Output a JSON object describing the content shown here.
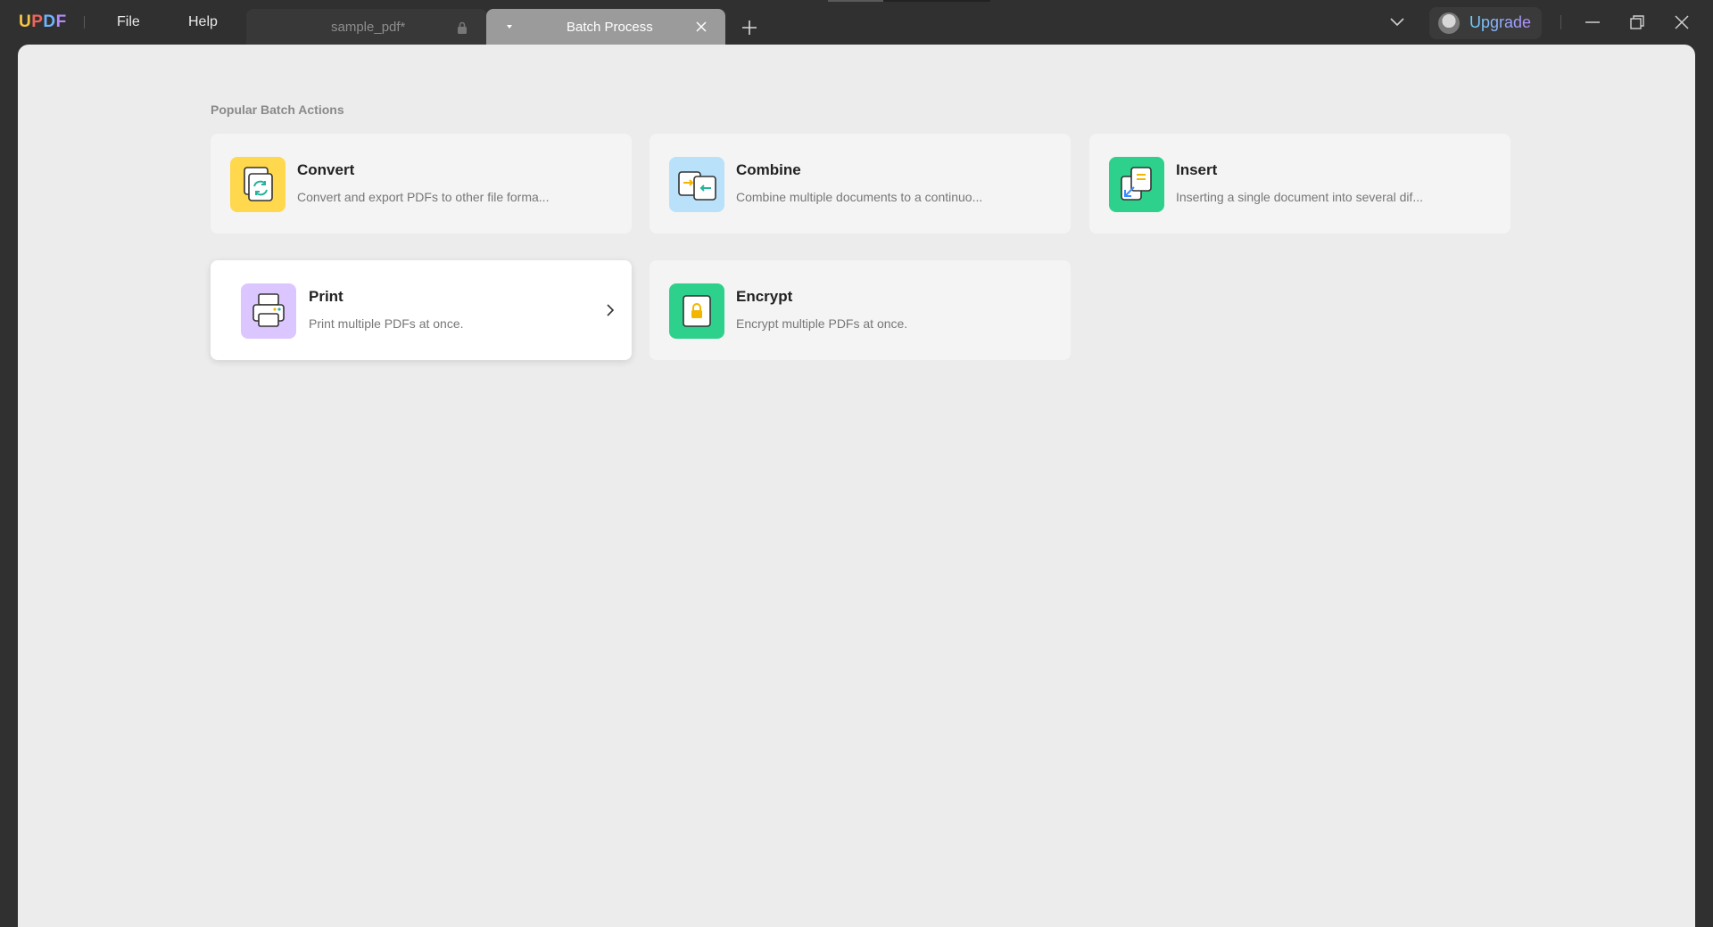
{
  "app": {
    "logo": {
      "u": "U",
      "p": "P",
      "d": "D",
      "f": "F"
    },
    "menu": {
      "file": "File",
      "help": "Help"
    }
  },
  "tabs": [
    {
      "label": "sample_pdf*",
      "locked": true,
      "active": false
    },
    {
      "label": "Batch Process",
      "active": true
    }
  ],
  "header": {
    "upgrade_label": "Upgrade"
  },
  "main": {
    "section_title": "Popular Batch Actions",
    "actions": [
      {
        "title": "Convert",
        "description": "Convert and export PDFs to other file forma...",
        "icon": "convert-icon",
        "color": "#ffd84d"
      },
      {
        "title": "Combine",
        "description": "Combine multiple documents to a continuo...",
        "icon": "combine-icon",
        "color": "#b9e1fa"
      },
      {
        "title": "Insert",
        "description": "Inserting a single document into several dif...",
        "icon": "insert-icon",
        "color": "#2ed18c"
      },
      {
        "title": "Print",
        "description": "Print multiple PDFs at once.",
        "icon": "printer-icon",
        "color": "#dcc6ff"
      },
      {
        "title": "Encrypt",
        "description": "Encrypt multiple PDFs at once.",
        "icon": "lock-icon",
        "color": "#2ed18c"
      }
    ]
  },
  "colors": {
    "titlebar": "#303030",
    "panel": "#ececec",
    "active_tab": "#9b9b9b",
    "upgrade_gradient": [
      "#6bd3ff",
      "#b48cff"
    ]
  }
}
